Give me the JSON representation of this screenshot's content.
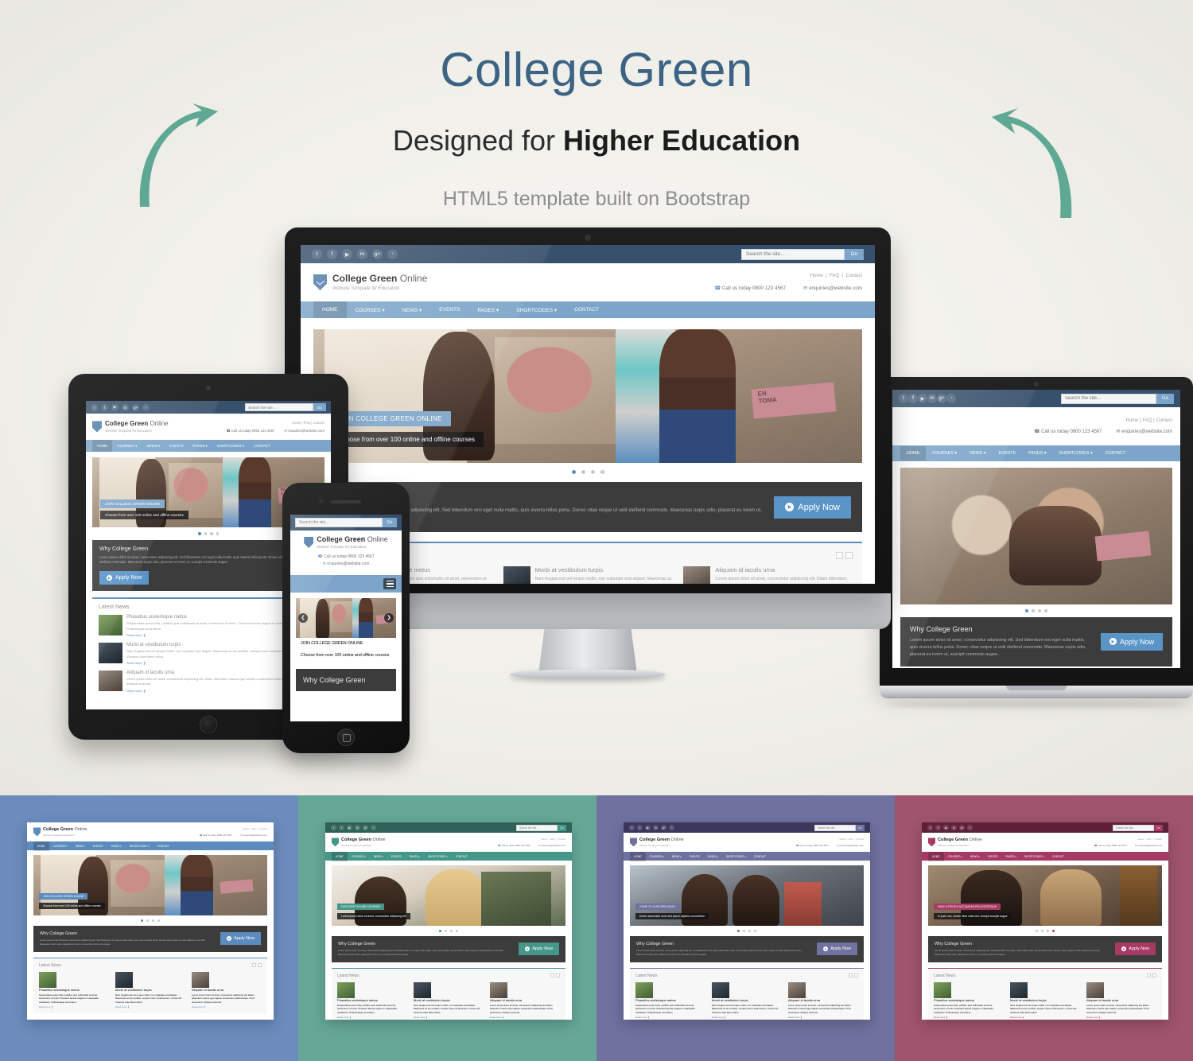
{
  "headline": {
    "title": "College Green",
    "subtitle_prefix": "Designed for ",
    "subtitle_strong": "Higher Education",
    "tagline": "HTML5 template built on Bootstrap"
  },
  "site": {
    "search": {
      "placeholder": "Search the site...",
      "button": "Go"
    },
    "social": [
      "twitter-icon",
      "facebook-icon",
      "youtube-icon",
      "linkedin-icon",
      "googleplus-icon",
      "rss-icon"
    ],
    "brand": {
      "name_bold": "College Green",
      "name_light": " Online",
      "tagline": "Website Template for Education"
    },
    "utility_links": [
      "Home",
      "FAQ",
      "Contact"
    ],
    "phone": "Call us today 0800 123 4567",
    "email": "enquiries@website.com",
    "nav": [
      "HOME",
      "COURSES",
      "NEWS",
      "EVENTS",
      "PAGES",
      "SHORTCODES",
      "CONTACT"
    ],
    "nav_caret": [
      false,
      true,
      true,
      false,
      true,
      true,
      false
    ],
    "hero": {
      "caption_title": "JOIN COLLEGE GREEN ONLINE",
      "caption_text": "Choose from over 100 online and offline courses",
      "dots": 4,
      "active_dot": 0
    },
    "why": {
      "title": "Why College Green",
      "body": "Lorem ipsum dolor sit amet, consectetur adipiscing elit. Sed bibendum orci eget nulla mattis, quis viverra tellus porta. Donec vitae neque ut velit eleifend commodo. Maecenas turpis odio, placerat eu lorem ut, suscipit commodo augue.",
      "button": "Apply Now"
    },
    "news": {
      "title": "Latest News",
      "prev": "◀",
      "next": "▶",
      "read_more": "Read more",
      "items": [
        {
          "title": "Phasellus scelerisque metus",
          "body": "Suspendisse purus felis, porttitor quis sollicitudin sit amet, elementum et tortor. Praesent lacinia magna in malesuada vestibulum. Pellentesque urna libero."
        },
        {
          "title": "Morbi at vestibulum turpis",
          "body": "Nam feugiat erat vel neque mollis, non vulputate erat aliquet. Maecenas ac leo porttitor, semper risus condimentum, cursus elit. Vivamus vitae libero tellus."
        },
        {
          "title": "Aliquam id iaculis urna",
          "body": "Lorem ipsum dolor sit amet, consectetur adipiscing elit. Etiam bibendum mauris eget sapien consectetur pellentesque. Proin elementum tristique euismod."
        }
      ]
    }
  },
  "variants": [
    {
      "name": "blue",
      "panel_color": "#6b8cbd",
      "accent": "#5b8cbd",
      "topbar": "#37506b",
      "nav": "#5b8cbd",
      "has_topbar": false,
      "hero_caption_title": "JOIN COLLEGE GREEN ONLINE",
      "hero_caption_text": "Choose from over 100 online and offline courses",
      "hero_bg": "#9a8a7c",
      "active_dot": 0
    },
    {
      "name": "green",
      "panel_color": "#66a897",
      "accent": "#45978a",
      "topbar": "#2f6158",
      "nav": "#45978a",
      "has_topbar": true,
      "hero_caption_title": "DISCOVER ONLINE COURSES",
      "hero_caption_text": "Lorem ipsum dolor sit amet, consectetur adipiscing elit",
      "hero_bg": "#c9b49a",
      "active_dot": 0
    },
    {
      "name": "purple",
      "panel_color": "#6f719f",
      "accent": "#6f719f",
      "topbar": "#39375c",
      "nav": "#6f719f",
      "has_topbar": true,
      "hero_caption_title": "COME TO OUR OPEN DAYS",
      "hero_caption_text": "Donec accumsan nunc sed ipsum dapibus consectetur",
      "hero_bg": "#8c8071",
      "active_dot": 0
    },
    {
      "name": "red",
      "panel_color": "#a0546e",
      "accent": "#a73a63",
      "topbar": "#5e2037",
      "nav": "#a73a63",
      "has_topbar": true,
      "hero_caption_title": "NAM ULTRICIES ACCUMSAN PELLENTESQUE",
      "hero_caption_text": "In justo orci, ornare vitae nulla sed, suscipit suscipit augue",
      "hero_bg": "#9a7a62",
      "active_dot": 3
    }
  ]
}
